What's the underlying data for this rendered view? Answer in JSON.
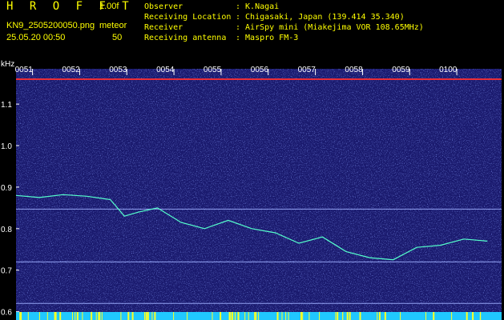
{
  "header": {
    "program": "H R O F F T",
    "version": "1.00f",
    "filename": "KN9_2505200050.png",
    "meteor_label": "meteor",
    "datetime": "25.05.20 00:50",
    "meteor_count": "50",
    "info": [
      {
        "key": "Observer",
        "value": ": K.Nagai"
      },
      {
        "key": "Receiving Location",
        "value": ": Chigasaki, Japan (139.414 35.340)"
      },
      {
        "key": "Receiver",
        "value": ": AirSpy mini (Miakejima VOR 108.65MHz)"
      },
      {
        "key": "Receiving antenna",
        "value": ": Maspro FM-3"
      }
    ]
  },
  "chart_data": {
    "type": "heatmap",
    "ylabel": "kHz",
    "yticks": [
      "1.1",
      "1.0",
      "0.9",
      "0.8",
      "0.7",
      "0.6"
    ],
    "ytick_values": [
      1.1,
      1.0,
      0.9,
      0.8,
      0.7,
      0.6
    ],
    "ylim": [
      0.58,
      1.185
    ],
    "xticks": [
      "0051",
      "0052",
      "0053",
      "0054",
      "0055",
      "0056",
      "0057",
      "0058",
      "0059",
      "0100"
    ],
    "xlim_minutes": [
      0,
      10.3
    ],
    "horizontal_lines_khz": [
      1.16,
      0.847,
      0.72,
      0.62
    ],
    "trace": {
      "x": [
        0,
        0.5,
        1,
        1.5,
        2,
        2.3,
        2.6,
        3,
        3.5,
        4,
        4.5,
        5,
        5.5,
        6,
        6.5,
        7,
        7.5,
        8,
        8.5,
        9,
        9.5,
        10
      ],
      "y": [
        0.88,
        0.875,
        0.882,
        0.878,
        0.87,
        0.83,
        0.84,
        0.85,
        0.815,
        0.8,
        0.82,
        0.8,
        0.79,
        0.765,
        0.78,
        0.745,
        0.73,
        0.725,
        0.755,
        0.76,
        0.775,
        0.77
      ]
    },
    "colors": {
      "background": "#1a1a6e",
      "trace": "#55ffcc",
      "tick_text": "#ffffff",
      "top_line": "#ff3030"
    }
  }
}
